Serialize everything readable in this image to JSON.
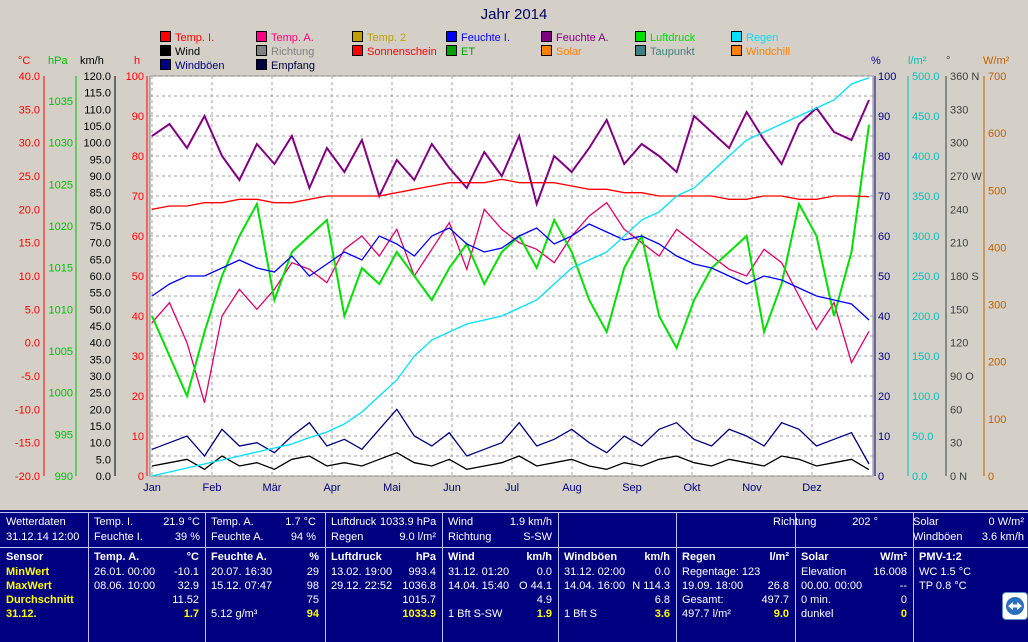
{
  "title": "Jahr 2014",
  "legend": [
    {
      "label": "Temp. I.",
      "color": "#ff0000"
    },
    {
      "label": "Temp. A.",
      "color": "#ff0080"
    },
    {
      "label": "Temp. 2",
      "color": "#c0a000"
    },
    {
      "label": "Feuchte I.",
      "color": "#0000ff"
    },
    {
      "label": "Feuchte A.",
      "color": "#800080"
    },
    {
      "label": "Luftdruck",
      "color": "#00e000"
    },
    {
      "label": "Regen",
      "color": "#00e0ff"
    },
    {
      "label": "Wind",
      "color": "#000000"
    },
    {
      "label": "Richtung",
      "color": "#808080"
    },
    {
      "label": "Sonnenschein",
      "color": "#ff0000"
    },
    {
      "label": "ET",
      "color": "#00a000"
    },
    {
      "label": "Solar",
      "color": "#ff8000"
    },
    {
      "label": "Taupunkt",
      "color": "#408080"
    },
    {
      "label": "Windchill",
      "color": "#ff8000"
    },
    {
      "label": "Windböen",
      "color": "#000080"
    },
    {
      "label": "Empfang",
      "color": "#000040"
    }
  ],
  "axis_units": {
    "celsius": "°C",
    "hpa": "hPa",
    "kmh": "km/h",
    "h": "h",
    "percent": "%",
    "lm2": "l/m²",
    "degree": "°",
    "wm2": "W/m²"
  },
  "chart_data": {
    "type": "line",
    "x_ticks": [
      "Jan",
      "Feb",
      "Mär",
      "Apr",
      "Mai",
      "Jun",
      "Jul",
      "Aug",
      "Sep",
      "Okt",
      "Nov",
      "Dez"
    ],
    "axes": {
      "celsius": {
        "ticks": [
          "40.0",
          "35.0",
          "30.0",
          "25.0",
          "20.0",
          "15.0",
          "10.0",
          "5.0",
          "0.0",
          "-5.0",
          "-10.0",
          "-15.0",
          "-20.0"
        ],
        "color": "#ff0000"
      },
      "hpa": {
        "ticks": [
          "1035",
          "1030",
          "1025",
          "1020",
          "1015",
          "1010",
          "1005",
          "1000",
          "995",
          "990"
        ],
        "color": "#00c000"
      },
      "kmh": {
        "ticks": [
          "120.0",
          "115.0",
          "110.0",
          "105.0",
          "100.0",
          "95.0",
          "90.0",
          "85.0",
          "80.0",
          "75.0",
          "70.0",
          "65.0",
          "60.0",
          "55.0",
          "50.0",
          "45.0",
          "40.0",
          "35.0",
          "30.0",
          "25.0",
          "20.0",
          "15.0",
          "10.0",
          "5.0",
          "0.0"
        ],
        "color": "#000000"
      },
      "h": {
        "ticks": [
          "100",
          "90",
          "80",
          "70",
          "60",
          "50",
          "40",
          "30",
          "20",
          "10",
          "0"
        ],
        "color": "#ff0000"
      },
      "percent": {
        "ticks": [
          "100",
          "90",
          "80",
          "70",
          "60",
          "50",
          "40",
          "30",
          "20",
          "10",
          "0"
        ],
        "color": "#000080"
      },
      "lm2": {
        "ticks": [
          "500.0",
          "450.0",
          "400.0",
          "350.0",
          "300.0",
          "250.0",
          "200.0",
          "150.0",
          "100.0",
          "50.0",
          "0.0"
        ],
        "color": "#00c0c0"
      },
      "degree": {
        "ticks": [
          "360 N",
          "330",
          "300",
          "270 W",
          "240",
          "210",
          "180 S",
          "150",
          "120",
          "90 O",
          "60",
          "30",
          "0 N"
        ],
        "color": "#404040"
      },
      "wm2": {
        "ticks": [
          "700",
          "600",
          "500",
          "400",
          "300",
          "200",
          "100",
          "0"
        ],
        "color": "#c06000"
      }
    },
    "series": [
      {
        "name": "Temp. A.",
        "color": "#e0006a",
        "values": [
          3,
          6,
          0,
          -9,
          4,
          8,
          5,
          8,
          12,
          11,
          9,
          14,
          16,
          13,
          17,
          10,
          14,
          18,
          11,
          20,
          17,
          15,
          14,
          12,
          16,
          19,
          21,
          17,
          15,
          13,
          17,
          15,
          13,
          11,
          10,
          14,
          12,
          7,
          2,
          6,
          -3,
          1.7
        ]
      },
      {
        "name": "Feuchte A.",
        "color": "#800080",
        "values": [
          85,
          88,
          82,
          90,
          80,
          74,
          83,
          78,
          85,
          72,
          82,
          76,
          84,
          70,
          79,
          74,
          83,
          77,
          72,
          81,
          75,
          85,
          68,
          80,
          76,
          82,
          89,
          78,
          83,
          80,
          76,
          90,
          86,
          82,
          91,
          84,
          78,
          88,
          92,
          86,
          84,
          94
        ]
      },
      {
        "name": "Luftdruck",
        "color": "#00e000",
        "values": [
          1010,
          1005,
          1000,
          1008,
          1015,
          1020,
          1024,
          1012,
          1018,
          1020,
          1022,
          1010,
          1016,
          1014,
          1018,
          1015,
          1012,
          1016,
          1019,
          1014,
          1018,
          1020,
          1016,
          1022,
          1018,
          1012,
          1008,
          1016,
          1020,
          1010,
          1006,
          1012,
          1016,
          1018,
          1020,
          1008,
          1014,
          1024,
          1020,
          1010,
          1018,
          1033.9
        ]
      },
      {
        "name": "Feuchte I.",
        "color": "#0000ff",
        "values": [
          45,
          48,
          50,
          50,
          52,
          54,
          52,
          51,
          55,
          50,
          53,
          56,
          54,
          60,
          58,
          55,
          60,
          62,
          58,
          56,
          57,
          60,
          62,
          58,
          60,
          63,
          61,
          59,
          60,
          58,
          55,
          53,
          52,
          50,
          48,
          50,
          49,
          47,
          45,
          44,
          43,
          39
        ]
      },
      {
        "name": "Temp. I.",
        "color": "#ff0000",
        "values": [
          20,
          20.5,
          20.5,
          21,
          21,
          21.5,
          21.5,
          21,
          21,
          21.5,
          22,
          22,
          22,
          22,
          22.5,
          23,
          23.5,
          24,
          24,
          24,
          24.5,
          24,
          24,
          24,
          23.5,
          23,
          23,
          22.5,
          22.5,
          22,
          22,
          22,
          22,
          21.5,
          21.5,
          22,
          22,
          21.5,
          21.5,
          22,
          22,
          21.9
        ]
      },
      {
        "name": "Wind",
        "color": "#000000",
        "values": [
          3,
          4,
          5,
          2,
          6,
          3,
          4,
          2,
          5,
          6,
          3,
          4,
          3,
          5,
          7,
          4,
          3,
          5,
          2,
          3,
          4,
          6,
          3,
          4,
          5,
          3,
          2,
          4,
          3,
          5,
          6,
          4,
          3,
          5,
          4,
          3,
          6,
          5,
          3,
          4,
          5,
          1.9
        ]
      },
      {
        "name": "Windböen",
        "color": "#000080",
        "values": [
          8,
          10,
          12,
          6,
          14,
          9,
          10,
          7,
          12,
          16,
          9,
          11,
          8,
          14,
          20,
          12,
          9,
          13,
          6,
          8,
          10,
          16,
          9,
          11,
          14,
          10,
          7,
          12,
          9,
          14,
          16,
          11,
          9,
          14,
          12,
          9,
          16,
          14,
          9,
          11,
          13,
          3.6
        ]
      },
      {
        "name": "Regen",
        "color": "#00e0ff",
        "values": [
          0,
          5,
          10,
          15,
          20,
          25,
          30,
          35,
          40,
          48,
          55,
          65,
          80,
          100,
          120,
          150,
          170,
          180,
          190,
          195,
          200,
          210,
          220,
          240,
          260,
          270,
          280,
          300,
          320,
          330,
          350,
          360,
          380,
          400,
          420,
          430,
          440,
          450,
          460,
          470,
          490,
          497.7
        ]
      }
    ]
  },
  "panel": {
    "row1": {
      "wetterdaten": "Wetterdaten",
      "datetime": "31.12.14 12:00",
      "tempi_label": "Temp. I.",
      "tempi_val": "21.9 °C",
      "feuchtei_label": "Feuchte I.",
      "feuchtei_val": "39 %",
      "tempa_label": "Temp. A.",
      "tempa_val": "1.7 °C",
      "feuchtea_label": "Feuchte A.",
      "feuchtea_val": "94 %",
      "luftdruck_label": "Luftdruck",
      "luftdruck_val": "1033.9 hPa",
      "regen_label": "Regen",
      "regen_val": "9.0 l/m²",
      "wind_label": "Wind",
      "wind_val": "1.9 km/h",
      "richtung_label": "Richtung",
      "richtung_val": "S-SW",
      "richtung2_label": "Richtung",
      "richtung2_val": "202 °",
      "solar_label": "Solar",
      "solar_val": "0 W/m²",
      "windboeen_label": "Windböen",
      "windboeen_val": "3.6 km/h"
    },
    "sensor": {
      "header": "Sensor",
      "min": "MinWert",
      "max": "MaxWert",
      "avg": "Durchschnitt",
      "date": "31.12."
    },
    "tempa": {
      "header": "Temp. A.",
      "unit": "°C",
      "min_date": "26.01.  00:00",
      "min": "-10.1",
      "max_date": "08.06.  10:00",
      "max": "32.9",
      "avg": "11.52",
      "cur": "1.7"
    },
    "feuchtea": {
      "header": "Feuchte A.",
      "unit": "%",
      "min_date": "20.07.  16:30",
      "min": "29",
      "max_date": "15.12.  07:47",
      "max": "98",
      "avg": "75",
      "abs": "5.12 g/m³",
      "cur": "94"
    },
    "luftdruck": {
      "header": "Luftdruck",
      "unit": "hPa",
      "min_date": "13.02.  19:00",
      "min": "993.4",
      "max_date": "29.12.  22:52",
      "max": "1036.8",
      "avg": "1015.7",
      "cur": "1033.9"
    },
    "wind": {
      "header": "Wind",
      "unit": "km/h",
      "min_date": "31.12.  01:20",
      "min": "0.0",
      "max_date": "14.04.  15:40",
      "max": "O 44.1",
      "avg": "4.9",
      "bft": "1 Bft S-SW",
      "cur": "1.9"
    },
    "windboeen": {
      "header": "Windböen",
      "unit": "km/h",
      "min_date": "31.12.  02:00",
      "min": "0.0",
      "max_date": "14.04.  16:00",
      "max": "N 114.3",
      "avg": "6.8",
      "bft": "1 Bft S",
      "cur": "3.6"
    },
    "regen": {
      "header": "Regen",
      "unit": "l/m²",
      "tage": "Regentage: 123",
      "max_date": "19.09.  18:00",
      "max": "26.8",
      "gesamt_label": "Gesamt:",
      "gesamt": "497.7",
      "total": "497.7 l/m²",
      "cur": "9.0"
    },
    "solar": {
      "header": "Solar",
      "unit": "W/m²",
      "elev_label": "Elevation",
      "elev": "16.008",
      "max_date": "00.00.  00:00",
      "max": "--",
      "min_label": "0 min.",
      "min": "0",
      "dunkel": "dunkel",
      "cur": "0"
    },
    "pmv": {
      "header": "PMV-1:2",
      "wc": "WC 1.5 °C",
      "tp": "TP 0.8 °C"
    }
  }
}
